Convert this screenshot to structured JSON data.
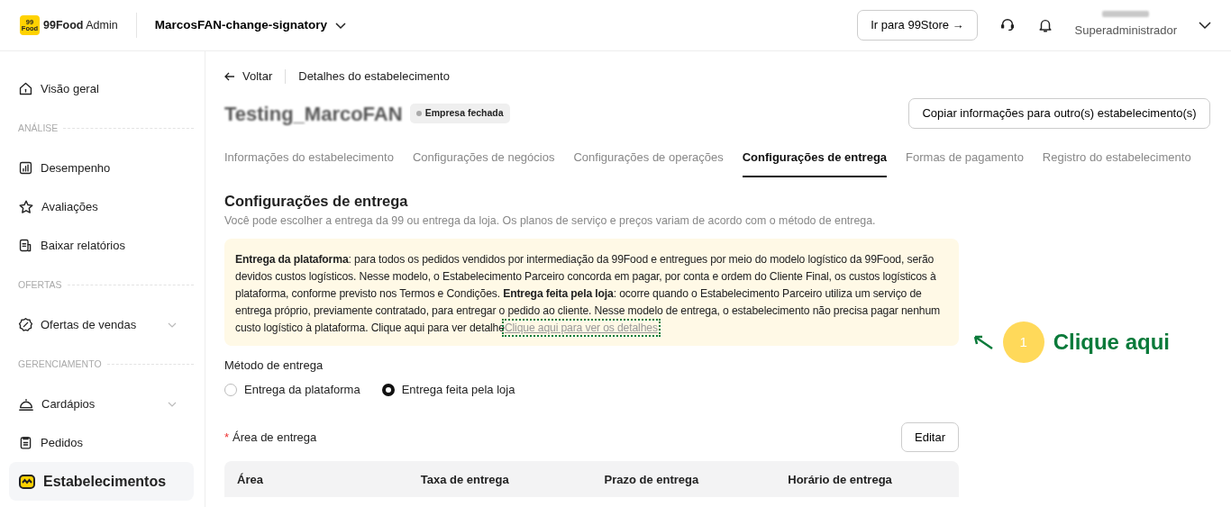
{
  "header": {
    "logo_lines": [
      "99",
      "Food"
    ],
    "brand": "99Food",
    "brand_suffix": "Admin",
    "store_selector": "MarcosFAN-change-signatory",
    "store_button": "Ir para 99Store →",
    "role": "Superadministrador"
  },
  "sidebar": {
    "items": [
      {
        "kind": "item",
        "label": "Visão geral",
        "expandable": false,
        "selected": false
      },
      {
        "kind": "section",
        "label": "ANÁLISE"
      },
      {
        "kind": "item",
        "label": "Desempenho",
        "expandable": false,
        "selected": false
      },
      {
        "kind": "item",
        "label": "Avaliações",
        "expandable": false,
        "selected": false
      },
      {
        "kind": "item",
        "label": "Baixar relatórios",
        "expandable": false,
        "selected": false
      },
      {
        "kind": "section",
        "label": "OFERTAS"
      },
      {
        "kind": "item",
        "label": "Ofertas de vendas",
        "expandable": true,
        "selected": false
      },
      {
        "kind": "section",
        "label": "GERENCIAMENTO"
      },
      {
        "kind": "item",
        "label": "Cardápios",
        "expandable": true,
        "selected": false
      },
      {
        "kind": "item",
        "label": "Pedidos",
        "expandable": false,
        "selected": false
      },
      {
        "kind": "item",
        "label": "Estabelecimentos",
        "expandable": false,
        "selected": true
      }
    ]
  },
  "main": {
    "back": "Voltar",
    "breadcrumb": "Detalhes do estabelecimento",
    "store_name": "Testing_MarcoFAN",
    "status": "Empresa fechada",
    "copy_button": "Copiar informações para outro(s) estabelecimento(s)",
    "tabs": [
      {
        "label": "Informações do estabelecimento",
        "selected": false
      },
      {
        "label": "Configurações de negócios",
        "selected": false
      },
      {
        "label": "Configurações de operações",
        "selected": false
      },
      {
        "label": "Configurações de entrega",
        "selected": true
      },
      {
        "label": "Formas de pagamento",
        "selected": false
      },
      {
        "label": "Registro do estabelecimento",
        "selected": false
      }
    ],
    "section_title": "Configurações de entrega",
    "section_subtitle": "Você pode escolher a entrega da 99 ou entrega da loja. Os planos de serviço e preços variam de acordo com o método de entrega.",
    "notice": "**Entrega da plataforma**: para todos os pedidos vendidos por intermediação da 99Food e entregues por meio do modelo logístico da 99Food, serão devidos custos logísticos. Nesse modelo, o Estabelecimento Parceiro concorda em pagar, por conta e ordem do Cliente Final, os custos logísticos à plataforma, conforme previsto nos Termos e Condições. **Entrega feita pela loja**: ocorre quando o Estabelecimento Parceiro utiliza um serviço de entrega próprio, previamente contratado, para entregar o pedido ao cliente. Nesse modelo de entrega, o estabelecimento não precisa pagar nenhum custo logístico à plataforma. Clique aqui para ver detalhe",
    "notice_link": "Clique aqui para ver os detalhes",
    "method_label": "Método de entrega",
    "methods": [
      {
        "label": "Entrega da plataforma",
        "selected": false
      },
      {
        "label": "Entrega feita pela loja",
        "selected": true
      }
    ],
    "required_mark": "*",
    "area_label": "Área de entrega",
    "edit_button": "Editar",
    "table": {
      "columns": [
        "Área",
        "Taxa de entrega",
        "Prazo de entrega",
        "Horário de entrega"
      ]
    }
  },
  "annotation": {
    "number": "1",
    "label": "Clique aqui"
  }
}
